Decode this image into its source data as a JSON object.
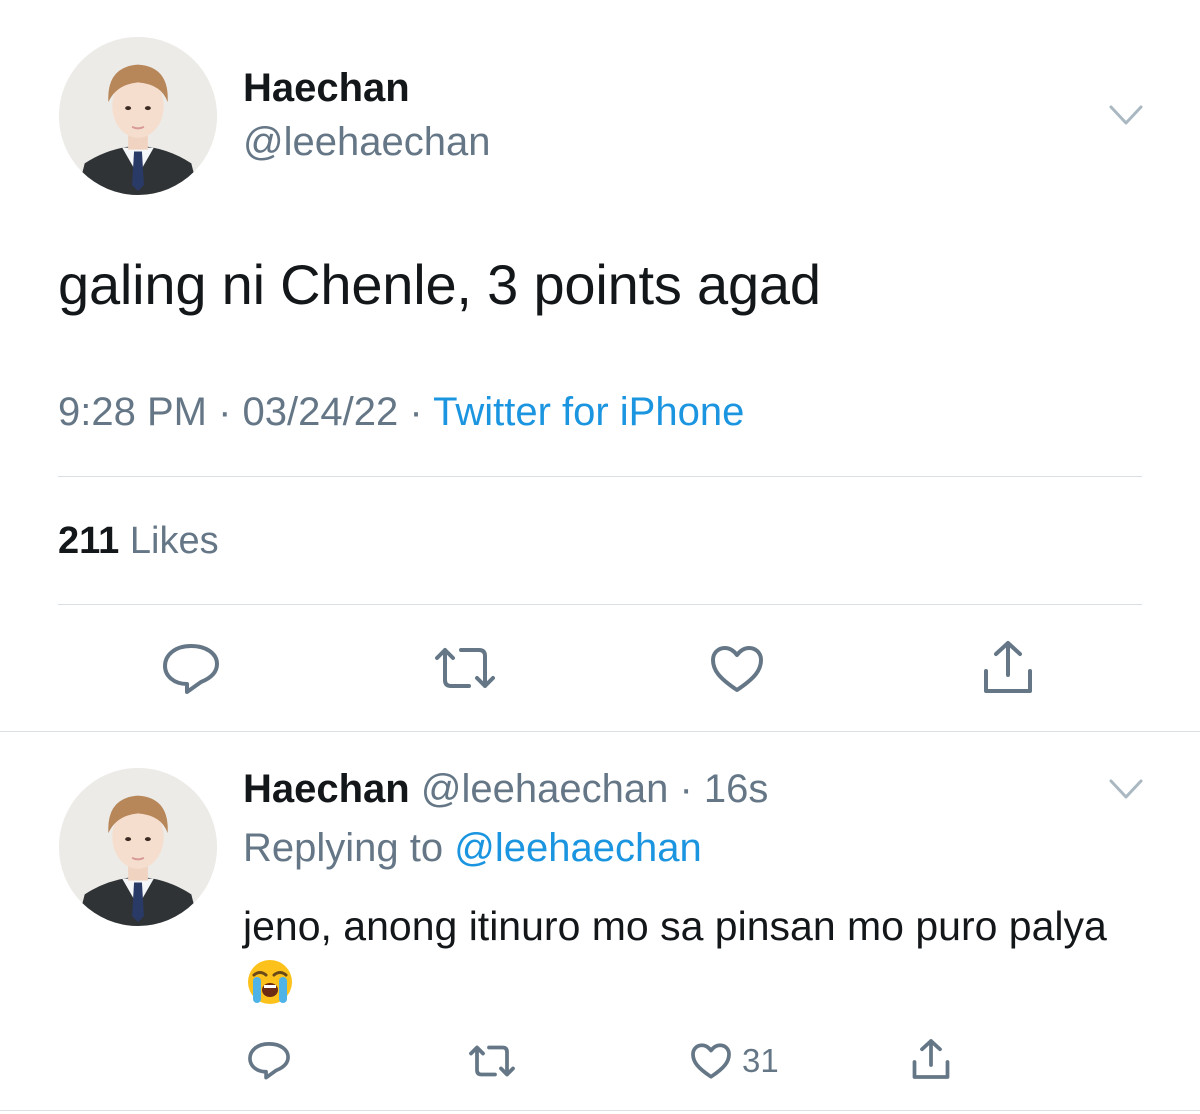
{
  "main_tweet": {
    "display_name": "Haechan",
    "handle": "@leehaechan",
    "text": "galing ni Chenle, 3 points agad",
    "time": "9:28 PM",
    "date": "03/24/22",
    "separator": "·",
    "source": "Twitter for iPhone",
    "likes_count": "211",
    "likes_label": "Likes"
  },
  "reply_tweet": {
    "display_name": "Haechan",
    "handle_time": "@leehaechan · 16s",
    "replying_label": "Replying to",
    "replying_to": "@leehaechan",
    "text": "jeno, anong itinuro mo sa pinsan mo puro palya",
    "emoji": "loudly-crying-face",
    "like_count": "31"
  },
  "icons": {
    "reply": "reply-icon",
    "retweet": "retweet-icon",
    "like": "heart-icon",
    "share": "share-icon",
    "more": "chevron-down-icon"
  },
  "colors": {
    "text": "#14171a",
    "secondary": "#657786",
    "link": "#1b95e0",
    "divider": "#dadfe3"
  }
}
